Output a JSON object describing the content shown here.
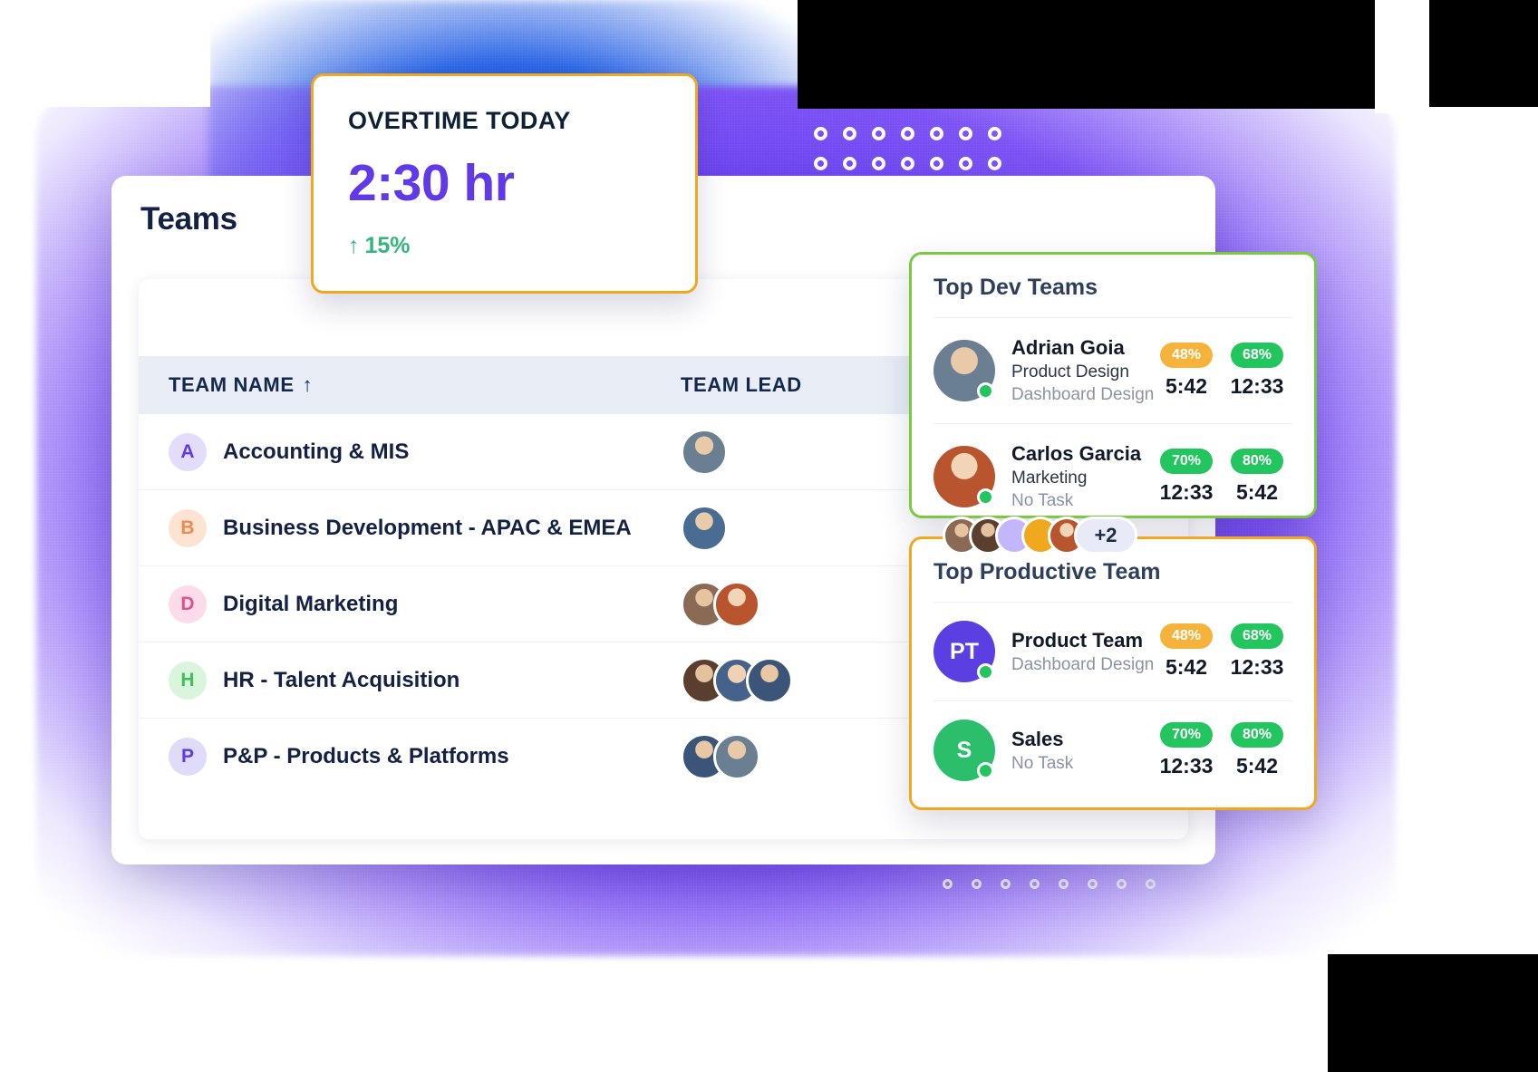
{
  "colors": {
    "accent_purple": "#6039e8",
    "accent_amber": "#f0a81e",
    "accent_green": "#7ac943",
    "status_green": "#22c55e",
    "pill_amber": "#f5b33b",
    "text_dark": "#122144"
  },
  "overtime_card": {
    "label": "OVERTIME TODAY",
    "value": "2:30 hr",
    "delta_arrow": "↑",
    "delta": "15%"
  },
  "panel": {
    "title": "Teams",
    "table": {
      "columns": [
        {
          "label": "TEAM NAME",
          "sort_arrow": "↑"
        },
        {
          "label": "TEAM LEAD",
          "sort_arrow": ""
        }
      ],
      "rows": [
        {
          "initial": "A",
          "initial_bg": "#e3ddfb",
          "initial_color": "#6039e8",
          "name": "Accounting & MIS",
          "leads": 1
        },
        {
          "initial": "B",
          "initial_bg": "#fde3d2",
          "initial_color": "#ef8a4e",
          "name": "Business Development - APAC & EMEA",
          "leads": 1
        },
        {
          "initial": "D",
          "initial_bg": "#fcdcea",
          "initial_color": "#e0528e",
          "name": "Digital Marketing",
          "leads": 2
        },
        {
          "initial": "H",
          "initial_bg": "#d9f6dd",
          "initial_color": "#3fbf57",
          "name": "HR - Talent Acquisition",
          "leads": 3
        },
        {
          "initial": "P",
          "initial_bg": "#dedbfb",
          "initial_color": "#6039e8",
          "name": "P&P - Products & Platforms",
          "leads": 2
        }
      ]
    }
  },
  "avatar_cluster": {
    "more_label": "+2",
    "count": 4
  },
  "top_dev_teams": {
    "title": "Top Dev Teams",
    "rows": [
      {
        "name": "Adrian Goia",
        "role": "Product Design",
        "task": "Dashboard Design",
        "status": "online",
        "metric1_pct": "48%",
        "metric1_pill": "amber",
        "metric1_time": "5:42",
        "metric2_pct": "68%",
        "metric2_pill": "green",
        "metric2_time": "12:33"
      },
      {
        "name": "Carlos Garcia",
        "role": "Marketing",
        "task": "No Task",
        "status": "online",
        "metric1_pct": "70%",
        "metric1_pill": "green",
        "metric1_time": "12:33",
        "metric2_pct": "80%",
        "metric2_pill": "green",
        "metric2_time": "5:42"
      }
    ]
  },
  "top_productive_team": {
    "title": "Top Productive Team",
    "rows": [
      {
        "initials": "PT",
        "initials_bg": "#5b3fe0",
        "name": "Product Team",
        "task": "Dashboard Design",
        "status": "online",
        "metric1_pct": "48%",
        "metric1_pill": "amber",
        "metric1_time": "5:42",
        "metric2_pct": "68%",
        "metric2_pill": "green",
        "metric2_time": "12:33"
      },
      {
        "initials": "S",
        "initials_bg": "#2bbf6c",
        "name": "Sales",
        "task": "No Task",
        "status": "online",
        "metric1_pct": "70%",
        "metric1_pill": "green",
        "metric1_time": "12:33",
        "metric2_pct": "80%",
        "metric2_pill": "green",
        "metric2_time": "5:42"
      }
    ]
  }
}
